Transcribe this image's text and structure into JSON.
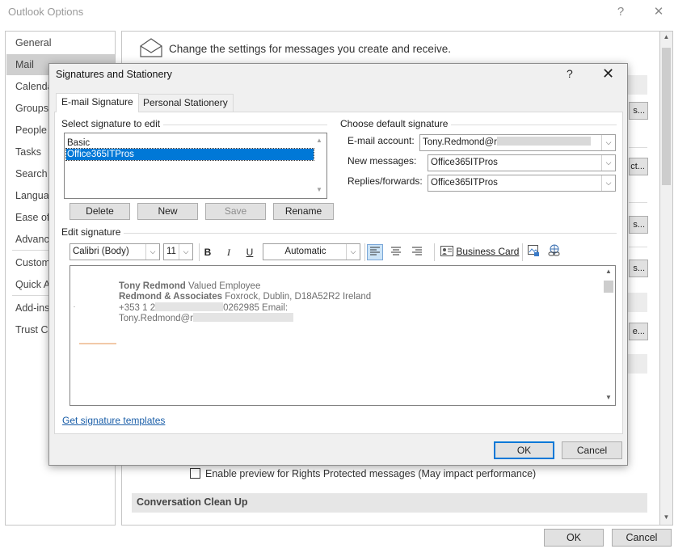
{
  "outer_window": {
    "title": "Outlook Options",
    "help_glyph": "?",
    "close_glyph": "✕",
    "sidebar": [
      {
        "label": "General"
      },
      {
        "label": "Mail"
      },
      {
        "label": "Calenda"
      },
      {
        "label": "Groups"
      },
      {
        "label": "People"
      },
      {
        "label": "Tasks"
      },
      {
        "label": "Search"
      },
      {
        "label": "Languag"
      },
      {
        "label": "Ease of A"
      },
      {
        "label": "Advance"
      },
      {
        "label": "Custom"
      },
      {
        "label": "Quick A"
      },
      {
        "label": "Add-ins"
      },
      {
        "label": "Trust Ce"
      }
    ],
    "mail_header": "Change the settings for messages you create and receive.",
    "right_buttons": [
      "s...",
      "ct...",
      "s...",
      "s...",
      "e..."
    ],
    "rights_checkbox_label": "Enable preview for Rights Protected messages (May impact performance)",
    "conversation_section": "Conversation Clean Up",
    "ok_label": "OK",
    "cancel_label": "Cancel"
  },
  "dialog": {
    "title": "Signatures and Stationery",
    "help_glyph": "?",
    "close_glyph": "✕",
    "tabs": [
      {
        "label": "E-mail Signature",
        "active": true
      },
      {
        "label": "Personal Stationery",
        "active": false
      }
    ],
    "select_group_label": "Select signature to edit",
    "signatures": [
      {
        "name": "Basic",
        "selected": false
      },
      {
        "name": "Office365ITPros",
        "selected": true
      }
    ],
    "buttons": {
      "delete": "Delete",
      "new": "New",
      "save": "Save",
      "rename": "Rename"
    },
    "default_group_label": "Choose default signature",
    "email_account_label": "E-mail account:",
    "email_account_value": "Tony.Redmond@r",
    "new_messages_label": "New messages:",
    "new_messages_value": "Office365ITPros",
    "replies_label": "Replies/forwards:",
    "replies_value": "Office365ITPros",
    "edit_group_label": "Edit signature",
    "toolbar": {
      "font": "Calibri (Body)",
      "size": "11",
      "bold": "B",
      "italic": "I",
      "underline": "U",
      "color": "Automatic",
      "business_card": "Business Card"
    },
    "signature_text": {
      "name": "Tony Redmond",
      "title": "Valued Employee",
      "company": "Redmond & Associates",
      "address": "Foxrock, Dublin, D18A52R2 Ireland",
      "phone_prefix": "+353 1 2",
      "phone_suffix": "0262985 Email:",
      "email_prefix": "Tony.Redmond@r"
    },
    "templates_link": "Get signature templates",
    "ok_label": "OK",
    "cancel_label": "Cancel"
  }
}
